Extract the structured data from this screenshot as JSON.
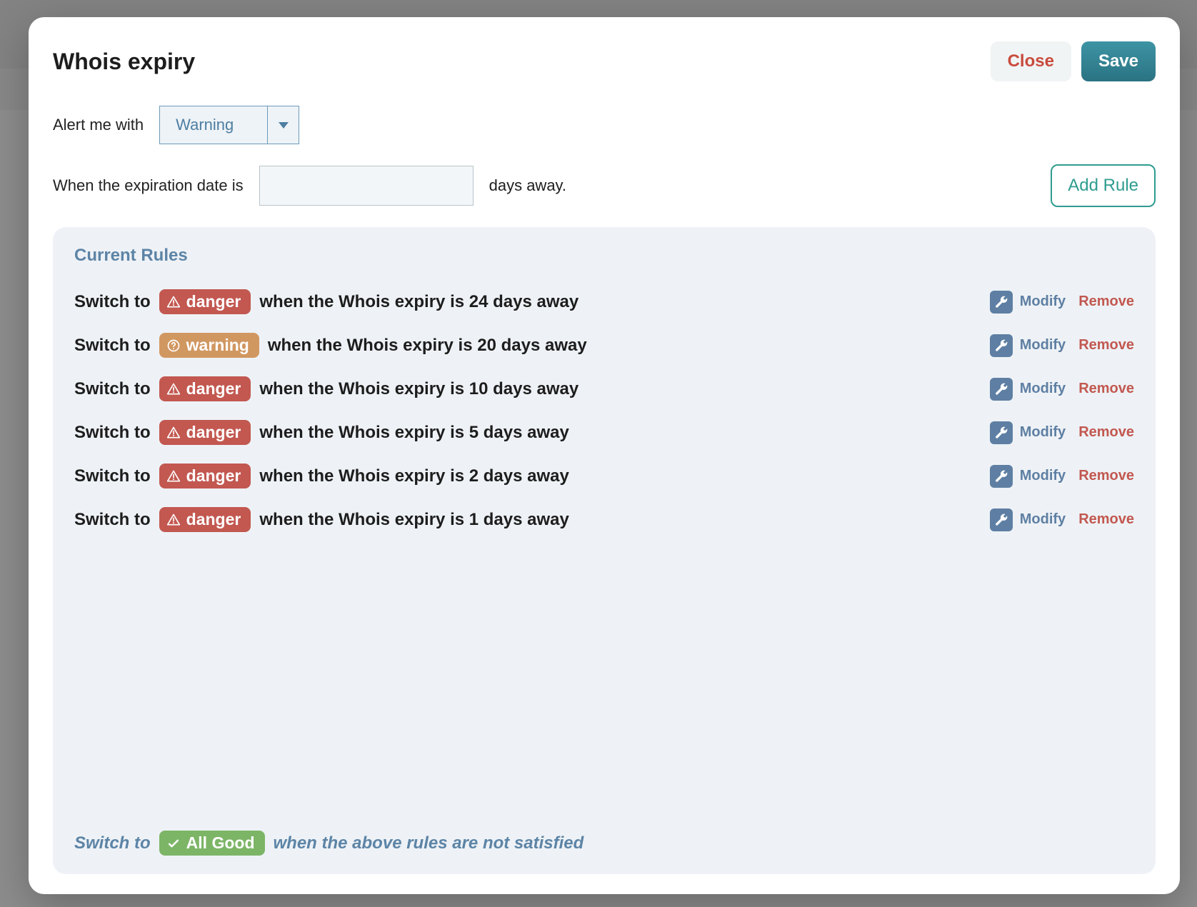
{
  "modal": {
    "title": "Whois expiry",
    "close_label": "Close",
    "save_label": "Save"
  },
  "form": {
    "alert_label": "Alert me with",
    "alert_selected": "Warning",
    "when_label": "When the expiration date is",
    "days_value": "",
    "days_suffix": "days away.",
    "add_rule_label": "Add Rule"
  },
  "rules": {
    "title": "Current Rules",
    "prefix": "Switch to",
    "mid": "when the Whois expiry is",
    "suffix": "days away",
    "modify_label": "Modify",
    "remove_label": "Remove",
    "items": [
      {
        "level": "danger",
        "level_label": "danger",
        "days": "24"
      },
      {
        "level": "warning",
        "level_label": "warning",
        "days": "20"
      },
      {
        "level": "danger",
        "level_label": "danger",
        "days": "10"
      },
      {
        "level": "danger",
        "level_label": "danger",
        "days": "5"
      },
      {
        "level": "danger",
        "level_label": "danger",
        "days": "2"
      },
      {
        "level": "danger",
        "level_label": "danger",
        "days": "1"
      }
    ]
  },
  "fallback": {
    "prefix": "Switch to",
    "badge_label": "All Good",
    "suffix": "when the above rules are not satisfied"
  }
}
